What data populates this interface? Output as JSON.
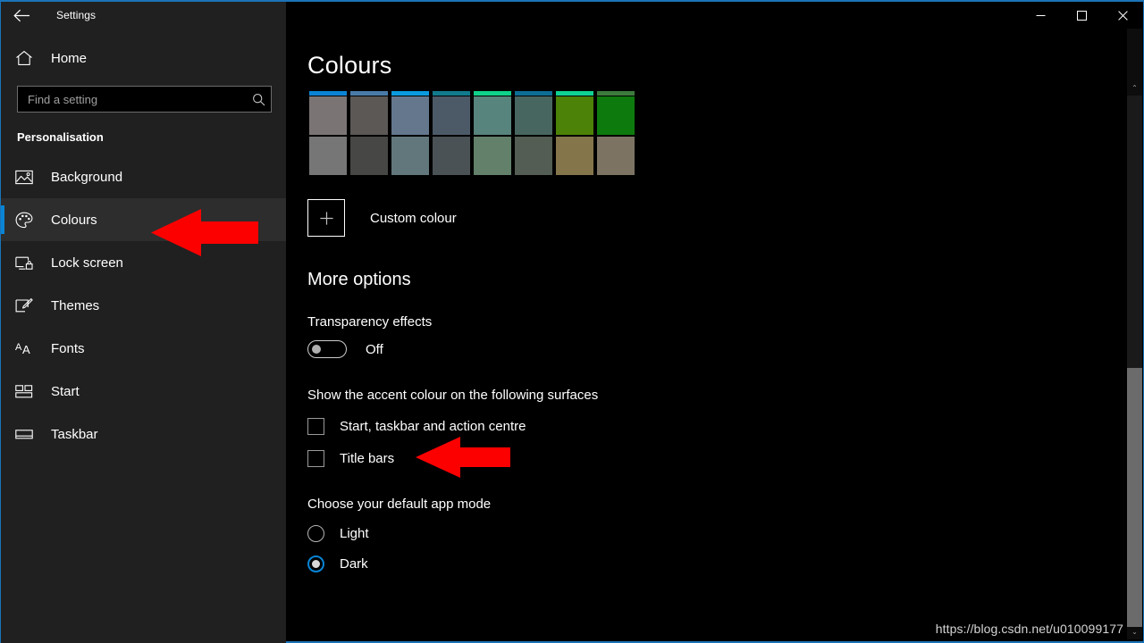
{
  "window": {
    "app_title": "Settings",
    "back_icon": "back-arrow-icon",
    "minimize_label": "—",
    "maximize_label": "□",
    "close_label": "✕",
    "accent_border": "#1a73b8"
  },
  "sidebar": {
    "home": {
      "label": "Home",
      "icon": "home-icon"
    },
    "search": {
      "placeholder": "Find a setting",
      "value": "",
      "icon": "search-icon"
    },
    "section_title": "Personalisation",
    "items": [
      {
        "label": "Background",
        "icon": "image-icon",
        "selected": false
      },
      {
        "label": "Colours",
        "icon": "palette-icon",
        "selected": true
      },
      {
        "label": "Lock screen",
        "icon": "lock-screen-icon",
        "selected": false
      },
      {
        "label": "Themes",
        "icon": "themes-brush-icon",
        "selected": false
      },
      {
        "label": "Fonts",
        "icon": "fonts-aa-icon",
        "selected": false
      },
      {
        "label": "Start",
        "icon": "start-tiles-icon",
        "selected": false
      },
      {
        "label": "Taskbar",
        "icon": "taskbar-icon",
        "selected": false
      }
    ],
    "selection_indicator_color": "#0a84d4"
  },
  "main": {
    "page_title": "Colours",
    "swatch_grid": {
      "columns": [
        {
          "accent": "#0a84d4",
          "top": "#7b7475",
          "bottom": "#767676"
        },
        {
          "accent": "#4a7ba8",
          "top": "#5b5855",
          "bottom": "#474746"
        },
        {
          "accent": "#0a9ade",
          "top": "#64778d",
          "bottom": "#62777c"
        },
        {
          "accent": "#117a8c",
          "top": "#4c5a68",
          "bottom": "#4a5256"
        },
        {
          "accent": "#0fd18a",
          "top": "#57847c",
          "bottom": "#63806a"
        },
        {
          "accent": "#0d6e94",
          "top": "#486660",
          "bottom": "#535d53"
        },
        {
          "accent": "#10d293",
          "top": "#4c8207",
          "bottom": "#85754b"
        },
        {
          "accent": "#3d7a3d",
          "top": "#0d7a0d",
          "bottom": "#7c7363"
        }
      ]
    },
    "custom_colour": {
      "label": "Custom colour",
      "icon": "plus-icon"
    },
    "more_options_title": "More options",
    "transparency": {
      "label": "Transparency effects",
      "state": "Off",
      "checked": false
    },
    "accent_surfaces": {
      "group_label": "Show the accent colour on the following surfaces",
      "options": [
        {
          "label": "Start, taskbar and action centre",
          "checked": false
        },
        {
          "label": "Title bars",
          "checked": false
        }
      ]
    },
    "app_mode": {
      "group_label": "Choose your default app mode",
      "options": [
        {
          "label": "Light",
          "selected": false
        },
        {
          "label": "Dark",
          "selected": true
        }
      ]
    }
  },
  "scrollbar": {
    "up_arrow": "⌃",
    "down_arrow": "⌄"
  },
  "annotations": {
    "arrow_colour": "#fc0000",
    "arrows": [
      {
        "name": "arrow-pointing-colours",
        "direction": "left"
      },
      {
        "name": "arrow-pointing-title-bars",
        "direction": "left"
      }
    ]
  },
  "watermark": {
    "text": "https://blog.csdn.net/u010099177"
  }
}
